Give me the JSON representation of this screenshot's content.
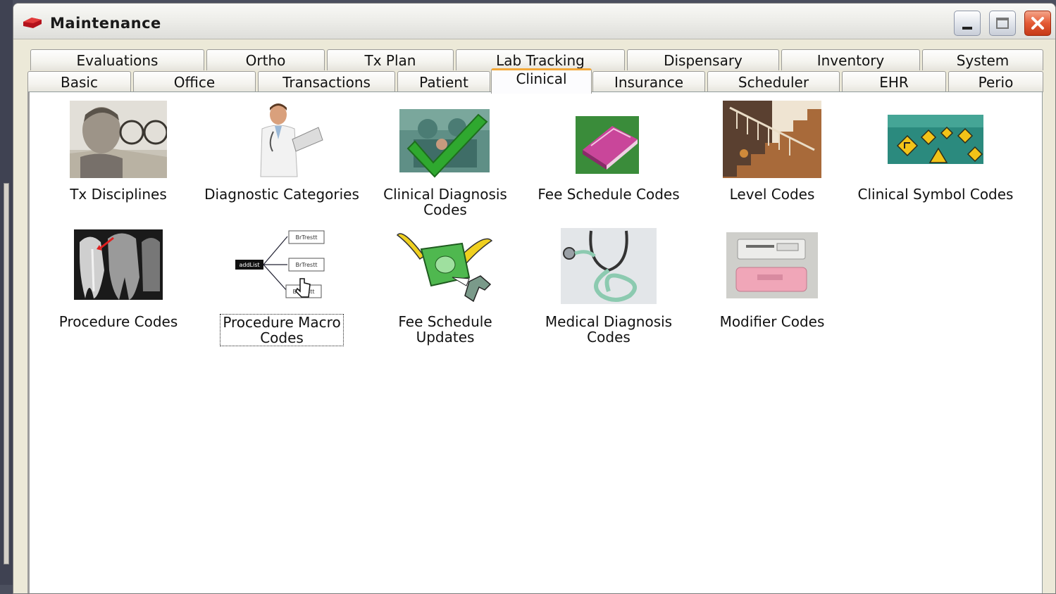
{
  "window": {
    "title": "Maintenance"
  },
  "tabs_row1": [
    "Evaluations",
    "Ortho",
    "Tx Plan",
    "Lab Tracking",
    "Dispensary",
    "Inventory",
    "System"
  ],
  "tabs_row2": [
    "Basic",
    "Office",
    "Transactions",
    "Patient",
    "Clinical",
    "Insurance",
    "Scheduler",
    "EHR",
    "Perio"
  ],
  "active_tab": "Clinical",
  "items": [
    {
      "label": "Tx Disciplines",
      "icon": "man-with-glasses-icon"
    },
    {
      "label": "Diagnostic Categories",
      "icon": "doctor-clipboard-icon"
    },
    {
      "label": "Clinical Diagnosis\nCodes",
      "icon": "surgery-checkmark-icon"
    },
    {
      "label": "Fee Schedule Codes",
      "icon": "book-icon"
    },
    {
      "label": "Level Codes",
      "icon": "staircase-icon"
    },
    {
      "label": "Clinical Symbol Codes",
      "icon": "road-signs-icon"
    },
    {
      "label": "Procedure Codes",
      "icon": "dental-xray-icon"
    },
    {
      "label": "Procedure Macro\nCodes",
      "icon": "macro-flow-icon"
    },
    {
      "label": "Fee Schedule\nUpdates",
      "icon": "flying-money-icon"
    },
    {
      "label": "Medical Diagnosis\nCodes",
      "icon": "stethoscope-icon"
    },
    {
      "label": "Modifier Codes",
      "icon": "eraser-icon"
    }
  ],
  "macro_diagram": {
    "root": "addList",
    "node": "BrTrestt"
  },
  "colors": {
    "active_tab_accent": "#f2a83a",
    "close_button": "#e45a35"
  }
}
